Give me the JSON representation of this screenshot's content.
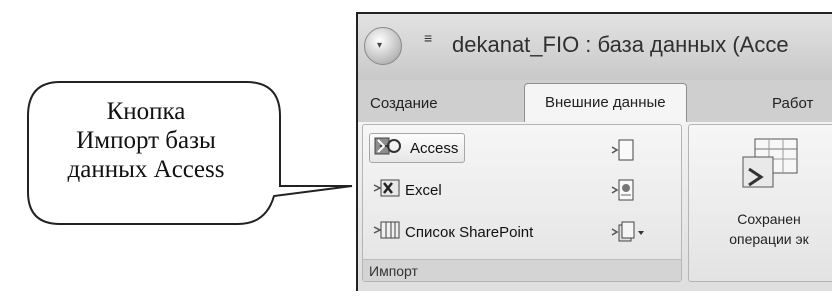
{
  "callout": {
    "lines": [
      "Кнопка",
      "Импорт базы",
      "данных Access"
    ]
  },
  "window": {
    "title": "dekanat_FIO : база данных (Acce",
    "qat_icon": "dropdown-arrow-icon",
    "orb_icon": "office-orb-icon"
  },
  "tabs": [
    {
      "label": "Создание"
    },
    {
      "label": "Внешние данные"
    },
    {
      "label": "Работ"
    }
  ],
  "ribbon": {
    "import_group": {
      "label": "Импорт",
      "buttons": [
        {
          "label": "Access",
          "icon": "access-key-icon"
        },
        {
          "label": "Excel",
          "icon": "excel-icon"
        },
        {
          "label": "Список SharePoint",
          "icon": "sharepoint-list-icon"
        }
      ],
      "small_buttons": [
        {
          "icon": "import-text-icon"
        },
        {
          "icon": "import-xml-icon"
        },
        {
          "icon": "more-import-icon"
        }
      ]
    },
    "save_group": {
      "label_line1": "Сохранен",
      "label_line2": "операции эк",
      "icon": "saved-imports-icon"
    }
  }
}
